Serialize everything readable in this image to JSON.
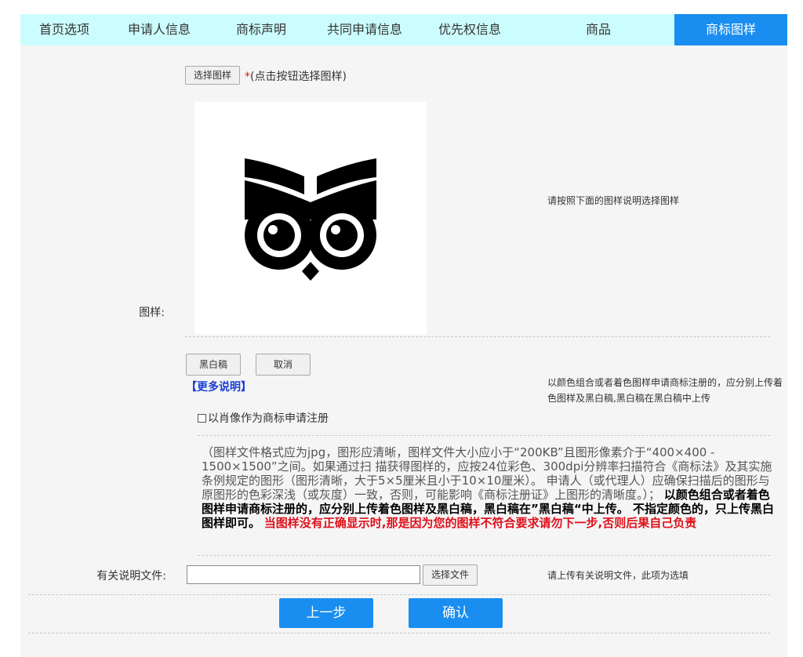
{
  "tabs": [
    {
      "label": "首页选项"
    },
    {
      "label": "申请人信息"
    },
    {
      "label": "商标声明"
    },
    {
      "label": "共同申请信息"
    },
    {
      "label": "优先权信息"
    },
    {
      "label": "商品"
    },
    {
      "label": "商标图样"
    }
  ],
  "active_tab": "商标图样",
  "image_section": {
    "label": "图样:",
    "select_button": "选择图样",
    "required_mark": "*",
    "select_hint": "(点击按钮选择图样)",
    "right_hint": "请按照下面的图样说明选择图样",
    "bw_button": "黑白稿",
    "cancel_button": "取消",
    "more_link": "【更多说明】",
    "color_note": "以颜色组合或者着色图样申请商标注册的，应分别上传着色图样及黑白稿,黑白稿在黑白稿中上传",
    "portrait_checkbox": "以肖像作为商标申请注册",
    "desc_normal": "（图样文件格式应为jpg，图形应清晰，图样文件大小应小于“200KB”且图形像素介于“400×400 - 1500×1500”之间。如果通过扫 描获得图样的，应按24位彩色、300dpi分辨率扫描符合《商标法》及其实施条例规定的图形（图形清晰，大于5×5厘米且小于10×10厘米）。 申请人（或代理人）应确保扫描后的图形与原图形的色彩深浅（或灰度）一致，否则，可能影响《商标注册证》上图形的清晰度。）；",
    "desc_bold": "以颜色组合或者着色图样申请商标注册的，应分别上传着色图样及黑白稿，黑白稿在”黑白稿“中上传。 不指定颜色的，只上传黑白图样即可。",
    "desc_red": "当图样没有正确显示时,那是因为您的图样不符合要求请勿下一步,否则后果自己负责"
  },
  "file_section": {
    "label": "有关说明文件:",
    "input_value": "",
    "choose_button": "选择文件",
    "hint": "请上传有关说明文件，此项为选填"
  },
  "actions": {
    "prev_button": "上一步",
    "confirm_button": "确认"
  },
  "colors": {
    "tab_bg": "#ccfdfe",
    "active_tab": "#1a8ef0",
    "primary_button": "#1a8ef0",
    "warning_text": "#e0101a",
    "link_text": "#1a3fd6"
  }
}
